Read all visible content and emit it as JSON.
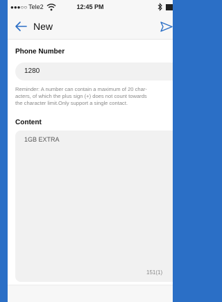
{
  "status_bar": {
    "signal_dots": "●●●○○",
    "carrier": "Tele2",
    "time": "12:45 PM"
  },
  "nav": {
    "title": "New"
  },
  "phone": {
    "label": "Phone Number",
    "value": "1280"
  },
  "reminder": {
    "lines": [
      "Reminder: A number can contain a maximum of 20 char-",
      "acters, of which the plus sign (+) does not count towards",
      "the character limit.Only support a single contact."
    ]
  },
  "content": {
    "label": "Content",
    "value": "1GB EXTRA",
    "counter": "151(1)"
  },
  "colors": {
    "accent": "#2b6fc6",
    "field_bg": "#f1f1f1",
    "bar_bg": "#f7f7f7"
  }
}
